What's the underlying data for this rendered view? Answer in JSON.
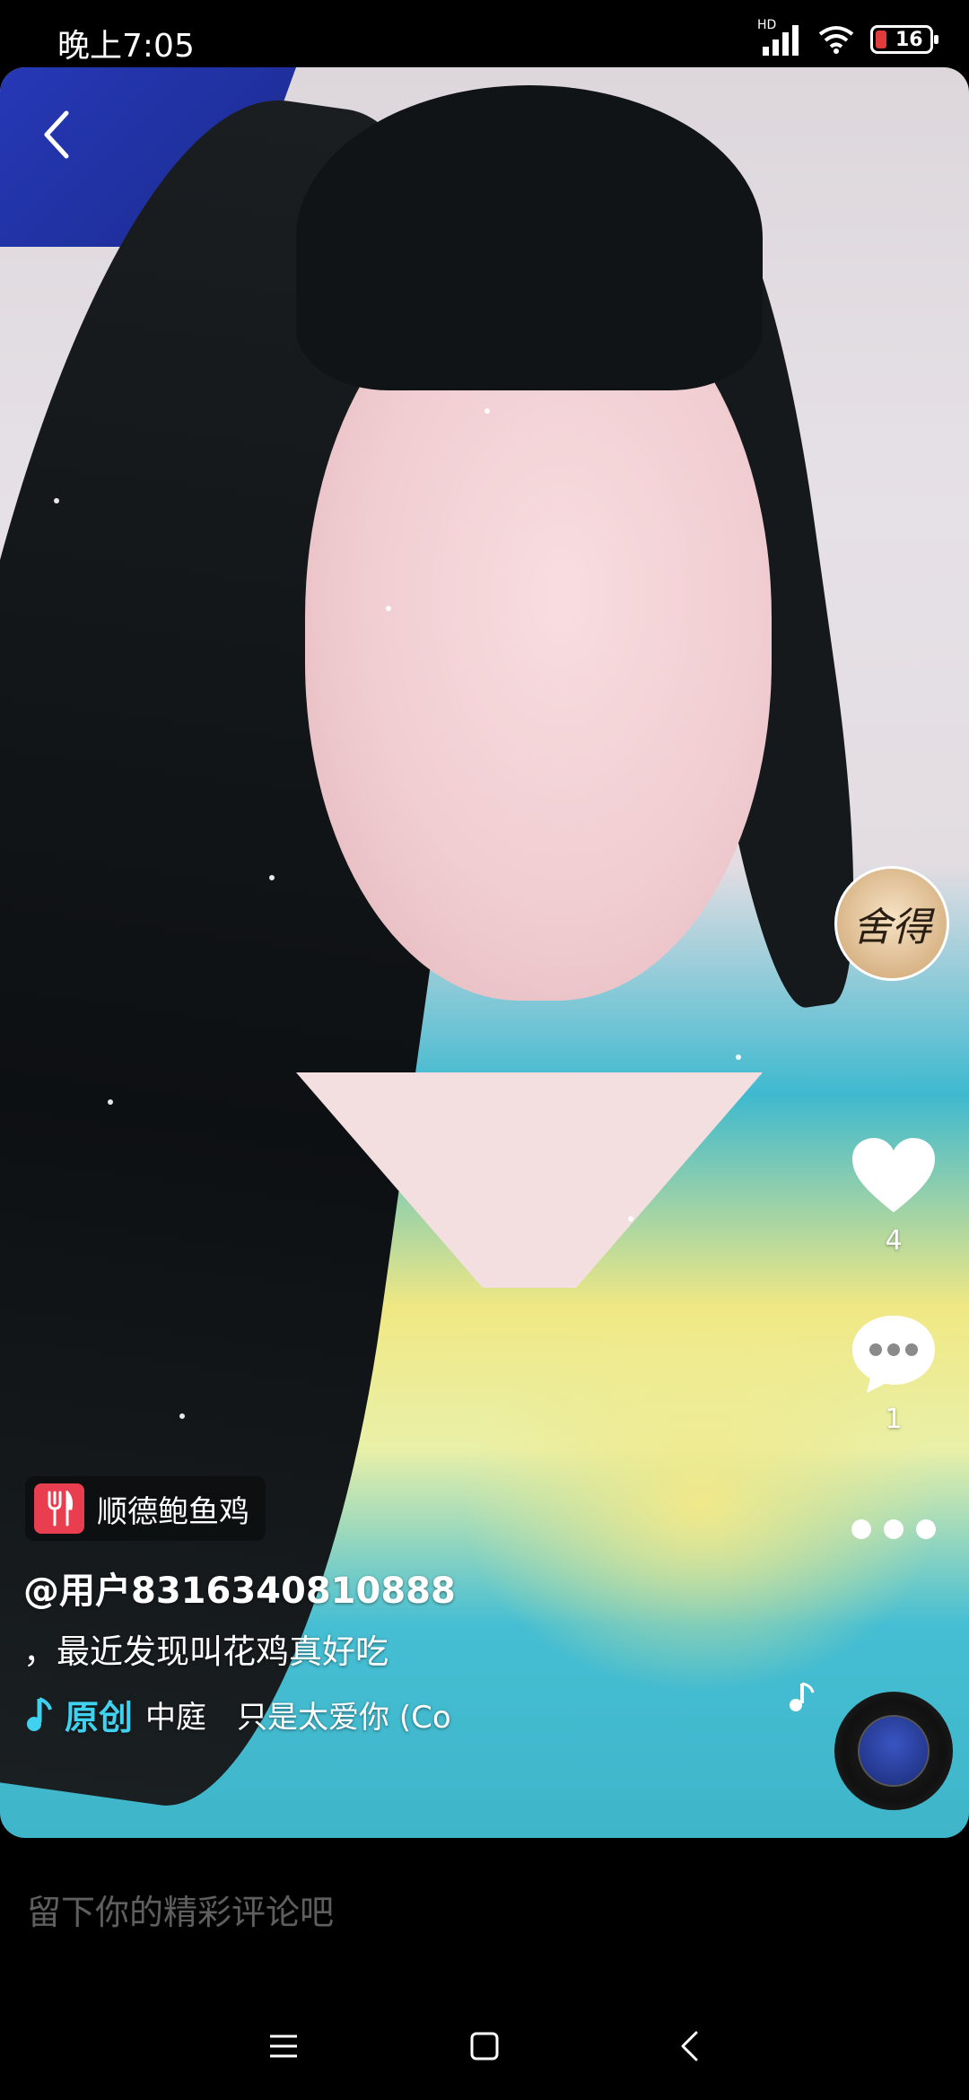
{
  "status_bar": {
    "time": "晚上7:05",
    "network": "HD",
    "battery": "16"
  },
  "post": {
    "poi_name": "顺德鲍鱼鸡",
    "author": "@用户8316340810888",
    "caption": "，最近发现叫花鸡真好吃",
    "music_tag": "原创",
    "music_title": "中庭　只是太爱你 (Co",
    "avatar_text": "舍得"
  },
  "actions": {
    "like_count": "4",
    "comment_count": "1"
  },
  "comment_bar": {
    "placeholder": "留下你的精彩评论吧"
  },
  "colors": {
    "accent": "#3fd2f0",
    "poi_icon": "#e83e4f"
  }
}
